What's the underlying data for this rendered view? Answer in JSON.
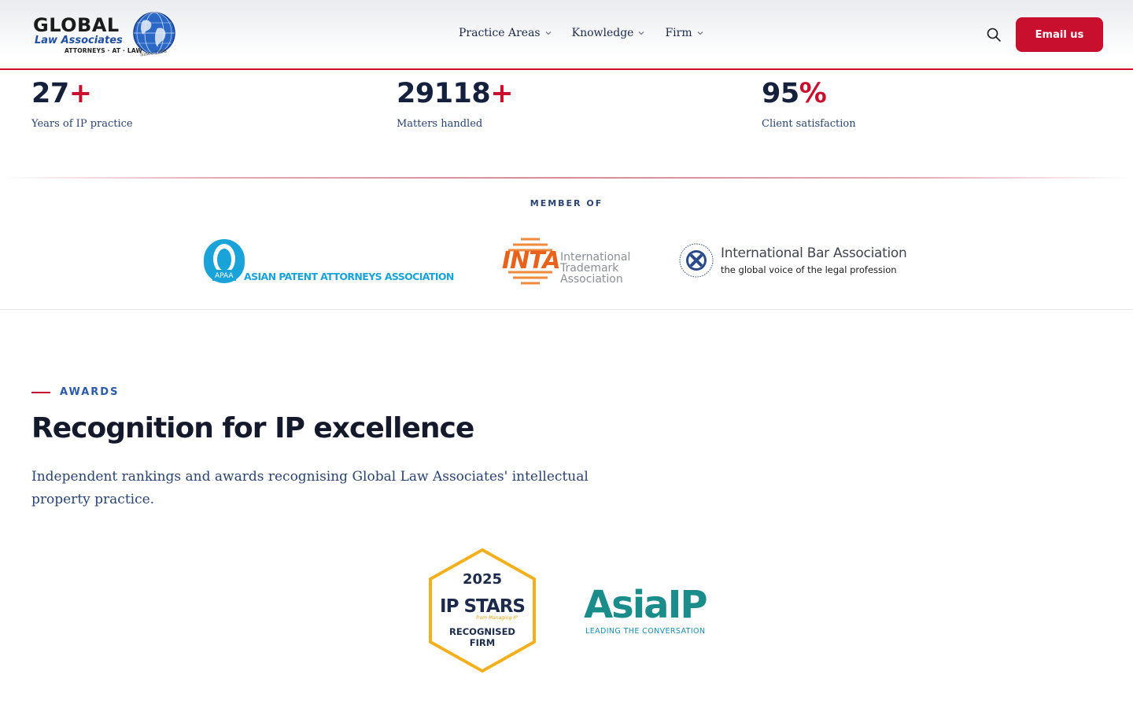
{
  "header": {
    "logo": {
      "name": "GLOBAL",
      "sub": "Law Associates",
      "tagline": "ATTORNEYS · AT · LAW",
      "since": "Since 1998"
    },
    "nav": [
      {
        "label": "Practice Areas"
      },
      {
        "label": "Knowledge"
      },
      {
        "label": "Firm"
      }
    ],
    "email_button": "Email us"
  },
  "stats": [
    {
      "value": "27",
      "suffix": "+",
      "label": "Years of IP practice"
    },
    {
      "value": "29118",
      "suffix": "+",
      "label": "Matters handled"
    },
    {
      "value": "95",
      "suffix": "%",
      "label": "Client satisfaction"
    }
  ],
  "members": {
    "heading": "MEMBER OF",
    "apaa": {
      "abbr": "APAA",
      "name": "ASIAN PATENT ATTORNEYS ASSOCIATION"
    },
    "inta": {
      "abbr": "INTA",
      "lines": [
        "International",
        "Trademark",
        "Association"
      ]
    },
    "iba": {
      "title": "International Bar Association",
      "subtitle": "the global voice of the legal profession"
    }
  },
  "awards": {
    "eyebrow": "AWARDS",
    "title": "Recognition for IP excellence",
    "description": "Independent rankings and awards recognising Global Law Associates' intellectual property practice.",
    "ipstars": {
      "year": "2025",
      "name": "IP STARS",
      "from": "from Managing IP",
      "line1": "RECOGNISED",
      "line2": "FIRM"
    },
    "asiaip": {
      "name": "AsiaIP",
      "tagline": "LEADING THE CONVERSATION"
    }
  },
  "colors": {
    "accent": "#c8102e",
    "navy": "#15203d",
    "link_blue": "#2a5aa8",
    "apaa_blue": "#1aa3d9",
    "inta_orange": "#e8621c",
    "asiaip_teal": "#1a8c8a",
    "ipstars_gold": "#f2b01e"
  }
}
